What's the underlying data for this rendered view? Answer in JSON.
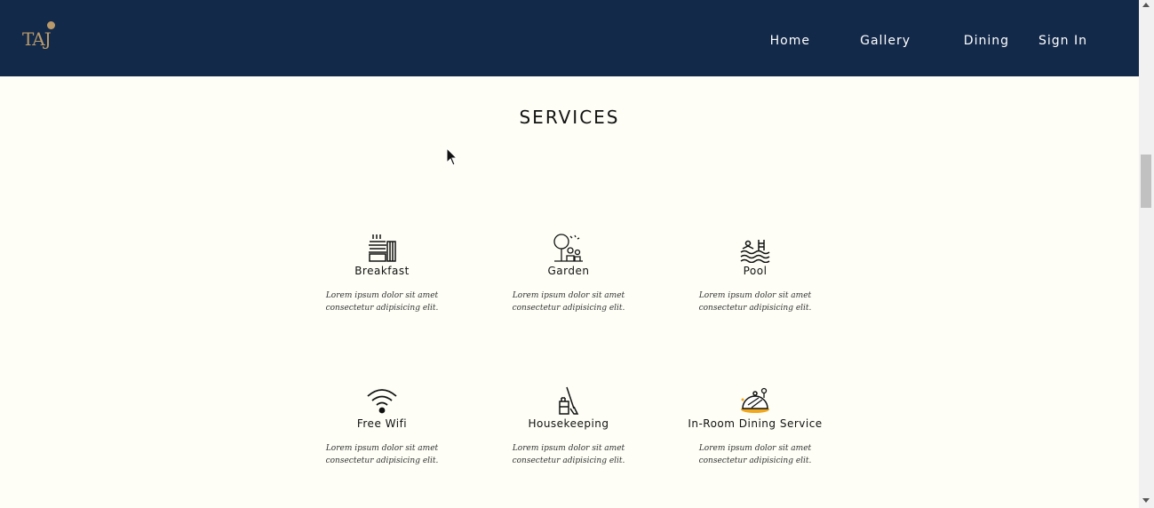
{
  "brand": {
    "logo_text": "TAJ"
  },
  "nav": {
    "items": [
      "Home",
      "Gallery",
      "Dining",
      "Sign In"
    ]
  },
  "section": {
    "title": "SERVICES"
  },
  "services": [
    {
      "name": "Breakfast",
      "icon": "breakfast-icon",
      "desc": "Lorem ipsum dolor sit amet consectetur adipisicing elit."
    },
    {
      "name": "Garden",
      "icon": "garden-icon",
      "desc": "Lorem ipsum dolor sit amet consectetur adipisicing elit."
    },
    {
      "name": "Pool",
      "icon": "pool-icon",
      "desc": "Lorem ipsum dolor sit amet consectetur adipisicing elit."
    },
    {
      "name": "Free Wifi",
      "icon": "wifi-icon",
      "desc": "Lorem ipsum dolor sit amet consectetur adipisicing elit."
    },
    {
      "name": "Housekeeping",
      "icon": "housekeeping-icon",
      "desc": "Lorem ipsum dolor sit amet consectetur adipisicing elit."
    },
    {
      "name": "In-Room Dining Service",
      "icon": "room-service-icon",
      "desc": "Lorem ipsum dolor sit amet consectetur adipisicing elit."
    }
  ],
  "colors": {
    "navbar": "#13294a",
    "background": "#fefef6",
    "logo": "#b89a6a",
    "accent": "#f2a81d"
  }
}
